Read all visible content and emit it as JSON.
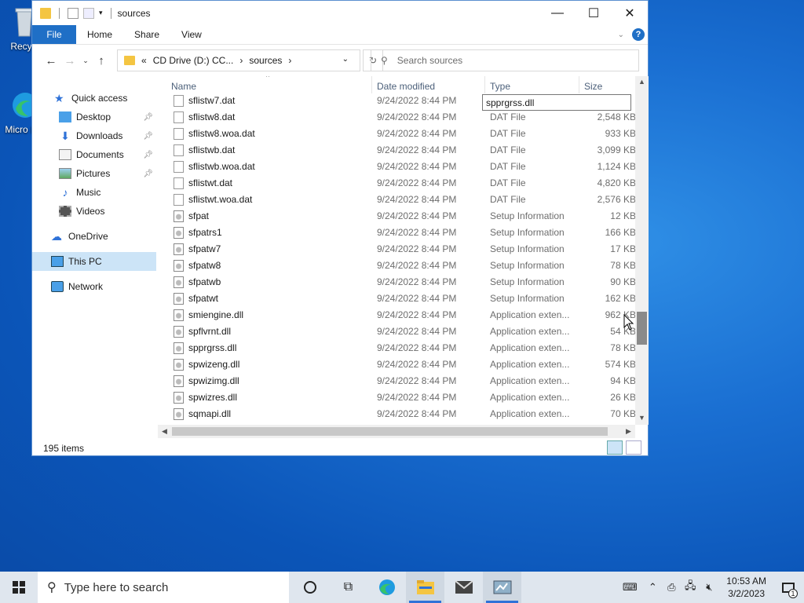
{
  "desktop": {
    "icons": [
      {
        "label": "Recyc",
        "icon": "recycle-bin-icon"
      },
      {
        "label": "Micro Ed",
        "icon": "edge-icon"
      }
    ]
  },
  "window": {
    "title": "sources",
    "ribbon": {
      "file": "File",
      "home": "Home",
      "share": "Share",
      "view": "View"
    },
    "address": {
      "prefix": "«",
      "drive": "CD Drive (D:) CC...",
      "sep1": "›",
      "folder": "sources",
      "sep2": "›"
    },
    "search_placeholder": "Search sources",
    "sidebar": [
      {
        "label": "Quick access",
        "icon": "star-icon",
        "pinned": false
      },
      {
        "label": "Desktop",
        "icon": "desktop-icon",
        "pinned": true
      },
      {
        "label": "Downloads",
        "icon": "download-icon",
        "pinned": true
      },
      {
        "label": "Documents",
        "icon": "document-icon",
        "pinned": true
      },
      {
        "label": "Pictures",
        "icon": "pictures-icon",
        "pinned": true
      },
      {
        "label": "Music",
        "icon": "music-icon",
        "pinned": false
      },
      {
        "label": "Videos",
        "icon": "video-icon",
        "pinned": false
      },
      {
        "label": "OneDrive",
        "icon": "cloud-icon",
        "pinned": false
      },
      {
        "label": "This PC",
        "icon": "computer-icon",
        "pinned": false
      },
      {
        "label": "Network",
        "icon": "network-icon",
        "pinned": false
      }
    ],
    "columns": {
      "name": "Name",
      "date": "Date modified",
      "type": "Type",
      "size": "Size"
    },
    "files": [
      {
        "name": "sflistw7.dat",
        "date": "9/24/2022 8:44 PM",
        "type": "",
        "size": "",
        "icon": "file"
      },
      {
        "name": "sflistw8.dat",
        "date": "9/24/2022 8:44 PM",
        "type": "DAT File",
        "size": "2,548 KB",
        "icon": "file"
      },
      {
        "name": "sflistw8.woa.dat",
        "date": "9/24/2022 8:44 PM",
        "type": "DAT File",
        "size": "933 KB",
        "icon": "file"
      },
      {
        "name": "sflistwb.dat",
        "date": "9/24/2022 8:44 PM",
        "type": "DAT File",
        "size": "3,099 KB",
        "icon": "file"
      },
      {
        "name": "sflistwb.woa.dat",
        "date": "9/24/2022 8:44 PM",
        "type": "DAT File",
        "size": "1,124 KB",
        "icon": "file"
      },
      {
        "name": "sflistwt.dat",
        "date": "9/24/2022 8:44 PM",
        "type": "DAT File",
        "size": "4,820 KB",
        "icon": "file"
      },
      {
        "name": "sflistwt.woa.dat",
        "date": "9/24/2022 8:44 PM",
        "type": "DAT File",
        "size": "2,576 KB",
        "icon": "file"
      },
      {
        "name": "sfpat",
        "date": "9/24/2022 8:44 PM",
        "type": "Setup Information",
        "size": "12 KB",
        "icon": "gear"
      },
      {
        "name": "sfpatrs1",
        "date": "9/24/2022 8:44 PM",
        "type": "Setup Information",
        "size": "166 KB",
        "icon": "gear"
      },
      {
        "name": "sfpatw7",
        "date": "9/24/2022 8:44 PM",
        "type": "Setup Information",
        "size": "17 KB",
        "icon": "gear"
      },
      {
        "name": "sfpatw8",
        "date": "9/24/2022 8:44 PM",
        "type": "Setup Information",
        "size": "78 KB",
        "icon": "gear"
      },
      {
        "name": "sfpatwb",
        "date": "9/24/2022 8:44 PM",
        "type": "Setup Information",
        "size": "90 KB",
        "icon": "gear"
      },
      {
        "name": "sfpatwt",
        "date": "9/24/2022 8:44 PM",
        "type": "Setup Information",
        "size": "162 KB",
        "icon": "gear"
      },
      {
        "name": "smiengine.dll",
        "date": "9/24/2022 8:44 PM",
        "type": "Application exten...",
        "size": "962 KB",
        "icon": "gear"
      },
      {
        "name": "spflvrnt.dll",
        "date": "9/24/2022 8:44 PM",
        "type": "Application exten...",
        "size": "54 KB",
        "icon": "gear"
      },
      {
        "name": "spprgrss.dll",
        "date": "9/24/2022 8:44 PM",
        "type": "Application exten...",
        "size": "78 KB",
        "icon": "gear"
      },
      {
        "name": "spwizeng.dll",
        "date": "9/24/2022 8:44 PM",
        "type": "Application exten...",
        "size": "574 KB",
        "icon": "gear"
      },
      {
        "name": "spwizimg.dll",
        "date": "9/24/2022 8:44 PM",
        "type": "Application exten...",
        "size": "94 KB",
        "icon": "gear"
      },
      {
        "name": "spwizres.dll",
        "date": "9/24/2022 8:44 PM",
        "type": "Application exten...",
        "size": "26 KB",
        "icon": "gear"
      },
      {
        "name": "sqmapi.dll",
        "date": "9/24/2022 8:44 PM",
        "type": "Application exten...",
        "size": "70 KB",
        "icon": "gear"
      }
    ],
    "tooltip": "spprgrss.dll",
    "status": "195 items"
  },
  "taskbar": {
    "search_placeholder": "Type here to search",
    "time": "10:53 AM",
    "date": "3/2/2023",
    "notification_count": "1"
  },
  "colors": {
    "accent": "#1f6fc6",
    "selection": "#cce4f7"
  }
}
